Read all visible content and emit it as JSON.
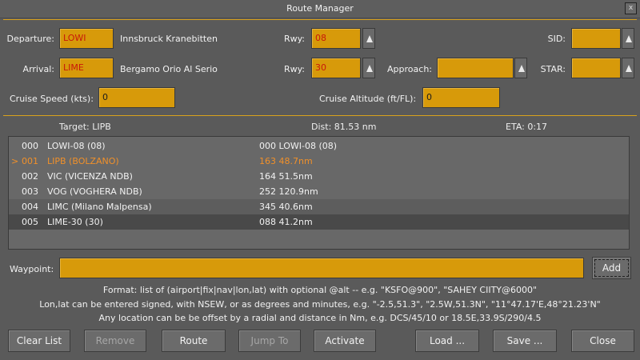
{
  "window": {
    "title": "Route Manager",
    "close_glyph": "x"
  },
  "departure": {
    "label": "Departure:",
    "code": "LOWI",
    "name": "Innsbruck Kranebitten",
    "rwy_label": "Rwy:",
    "rwy": "08",
    "sid_label": "SID:",
    "sid": ""
  },
  "arrival": {
    "label": "Arrival:",
    "code": "LIME",
    "name": "Bergamo Orio Al Serio",
    "rwy_label": "Rwy:",
    "rwy": "30",
    "approach_label": "Approach:",
    "approach": "",
    "star_label": "STAR:",
    "star": ""
  },
  "cruise": {
    "speed_label": "Cruise Speed (kts):",
    "speed": "0",
    "alt_label": "Cruise Altitude (ft/FL):",
    "alt": "0"
  },
  "status": {
    "target": "Target: LIPB",
    "dist": "Dist: 81.53 nm",
    "eta": "ETA: 0:17"
  },
  "route": [
    {
      "marker": "",
      "idx": "000",
      "name": "LOWI-08 (08)",
      "leg": "000   LOWI-08 (08)"
    },
    {
      "marker": ">",
      "idx": "001",
      "name": "LIPB  (BOLZANO)",
      "leg": "163  48.7nm"
    },
    {
      "marker": "",
      "idx": "002",
      "name": "VIC   (VICENZA NDB)",
      "leg": "164  51.5nm"
    },
    {
      "marker": "",
      "idx": "003",
      "name": "VOG   (VOGHERA NDB)",
      "leg": "252 120.9nm"
    },
    {
      "marker": "",
      "idx": "004",
      "name": "LIMC  (Milano Malpensa)",
      "leg": "345  40.6nm"
    },
    {
      "marker": "",
      "idx": "005",
      "name": "LIME-30 (30)",
      "leg": "088  41.2nm"
    }
  ],
  "waypoint": {
    "label": "Waypoint:",
    "value": "",
    "add_label": "Add"
  },
  "hints": [
    "Format: list of (airport|fix|nav|lon,lat) with optional @alt -- e.g. \"KSFO@900\", \"SAHEY CIITY@6000\"",
    "Lon,lat can be entered signed, with NSEW, or as degrees and minutes, e.g. \"-2.5,51.3\", \"2.5W,51.3N\", \"11°47.17'E,48°21.23'N\"",
    "Any location can be be offset by a radial and distance in Nm, e.g. DCS/45/10 or 18.5E,33.9S/290/4.5"
  ],
  "buttons": {
    "clear": "Clear List",
    "remove": "Remove",
    "route": "Route",
    "jump": "Jump To",
    "activate": "Activate",
    "load": "Load ...",
    "save": "Save ...",
    "close": "Close"
  },
  "colors": {
    "field": "#d79a0a",
    "separator": "#d9a21c",
    "current_waypoint": "#f0902a",
    "background": "#5a5a5a"
  }
}
